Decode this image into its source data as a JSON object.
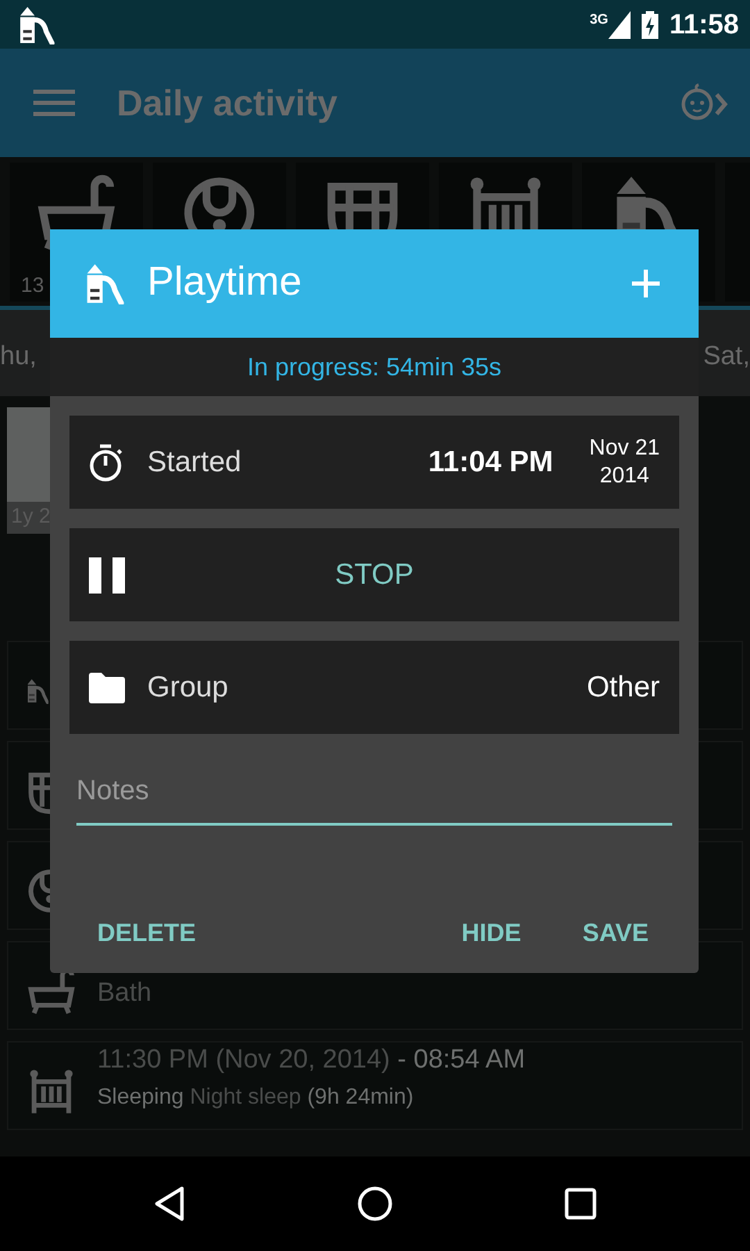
{
  "status_bar": {
    "network": "3G",
    "time": "11:58"
  },
  "toolbar": {
    "title": "Daily activity"
  },
  "activity_tiles": [
    {
      "kind": "bath",
      "label": "13"
    },
    {
      "kind": "bib"
    },
    {
      "kind": "diaper"
    },
    {
      "kind": "crib"
    },
    {
      "kind": "playground"
    },
    {
      "kind": "blank"
    }
  ],
  "date_strip": {
    "left": "hu,",
    "right": "Sat,"
  },
  "age_bar": {
    "label": "1y 2"
  },
  "entries": [
    {
      "kind": "playground"
    },
    {
      "kind": "diaper"
    },
    {
      "kind": "bib"
    },
    {
      "kind": "bath",
      "lines": [
        [
          {
            "text": "Bath",
            "strong": false
          }
        ]
      ]
    },
    {
      "kind": "crib",
      "lines": [
        [
          {
            "text": "11:30 PM (Nov 20, 2014)",
            "strong": false
          },
          {
            "text": " - 08:54 AM",
            "strong": true
          }
        ],
        [
          {
            "text": "Sleeping",
            "strong": true
          },
          {
            "text": " Night sleep ",
            "strong": false
          },
          {
            "text": "(9h 24min)",
            "strong": true
          }
        ]
      ]
    }
  ],
  "dialog": {
    "title": "Playtime",
    "progress": "In progress: 54min 35s",
    "started": {
      "label": "Started",
      "time": "11:04 PM",
      "date": [
        "Nov 21",
        "2014"
      ]
    },
    "stop": {
      "label": "STOP"
    },
    "group": {
      "label": "Group",
      "value": "Other"
    },
    "notes": {
      "placeholder": "Notes"
    },
    "actions": [
      {
        "label": "DELETE"
      },
      {
        "label": "HIDE"
      },
      {
        "label": "SAVE"
      }
    ]
  }
}
